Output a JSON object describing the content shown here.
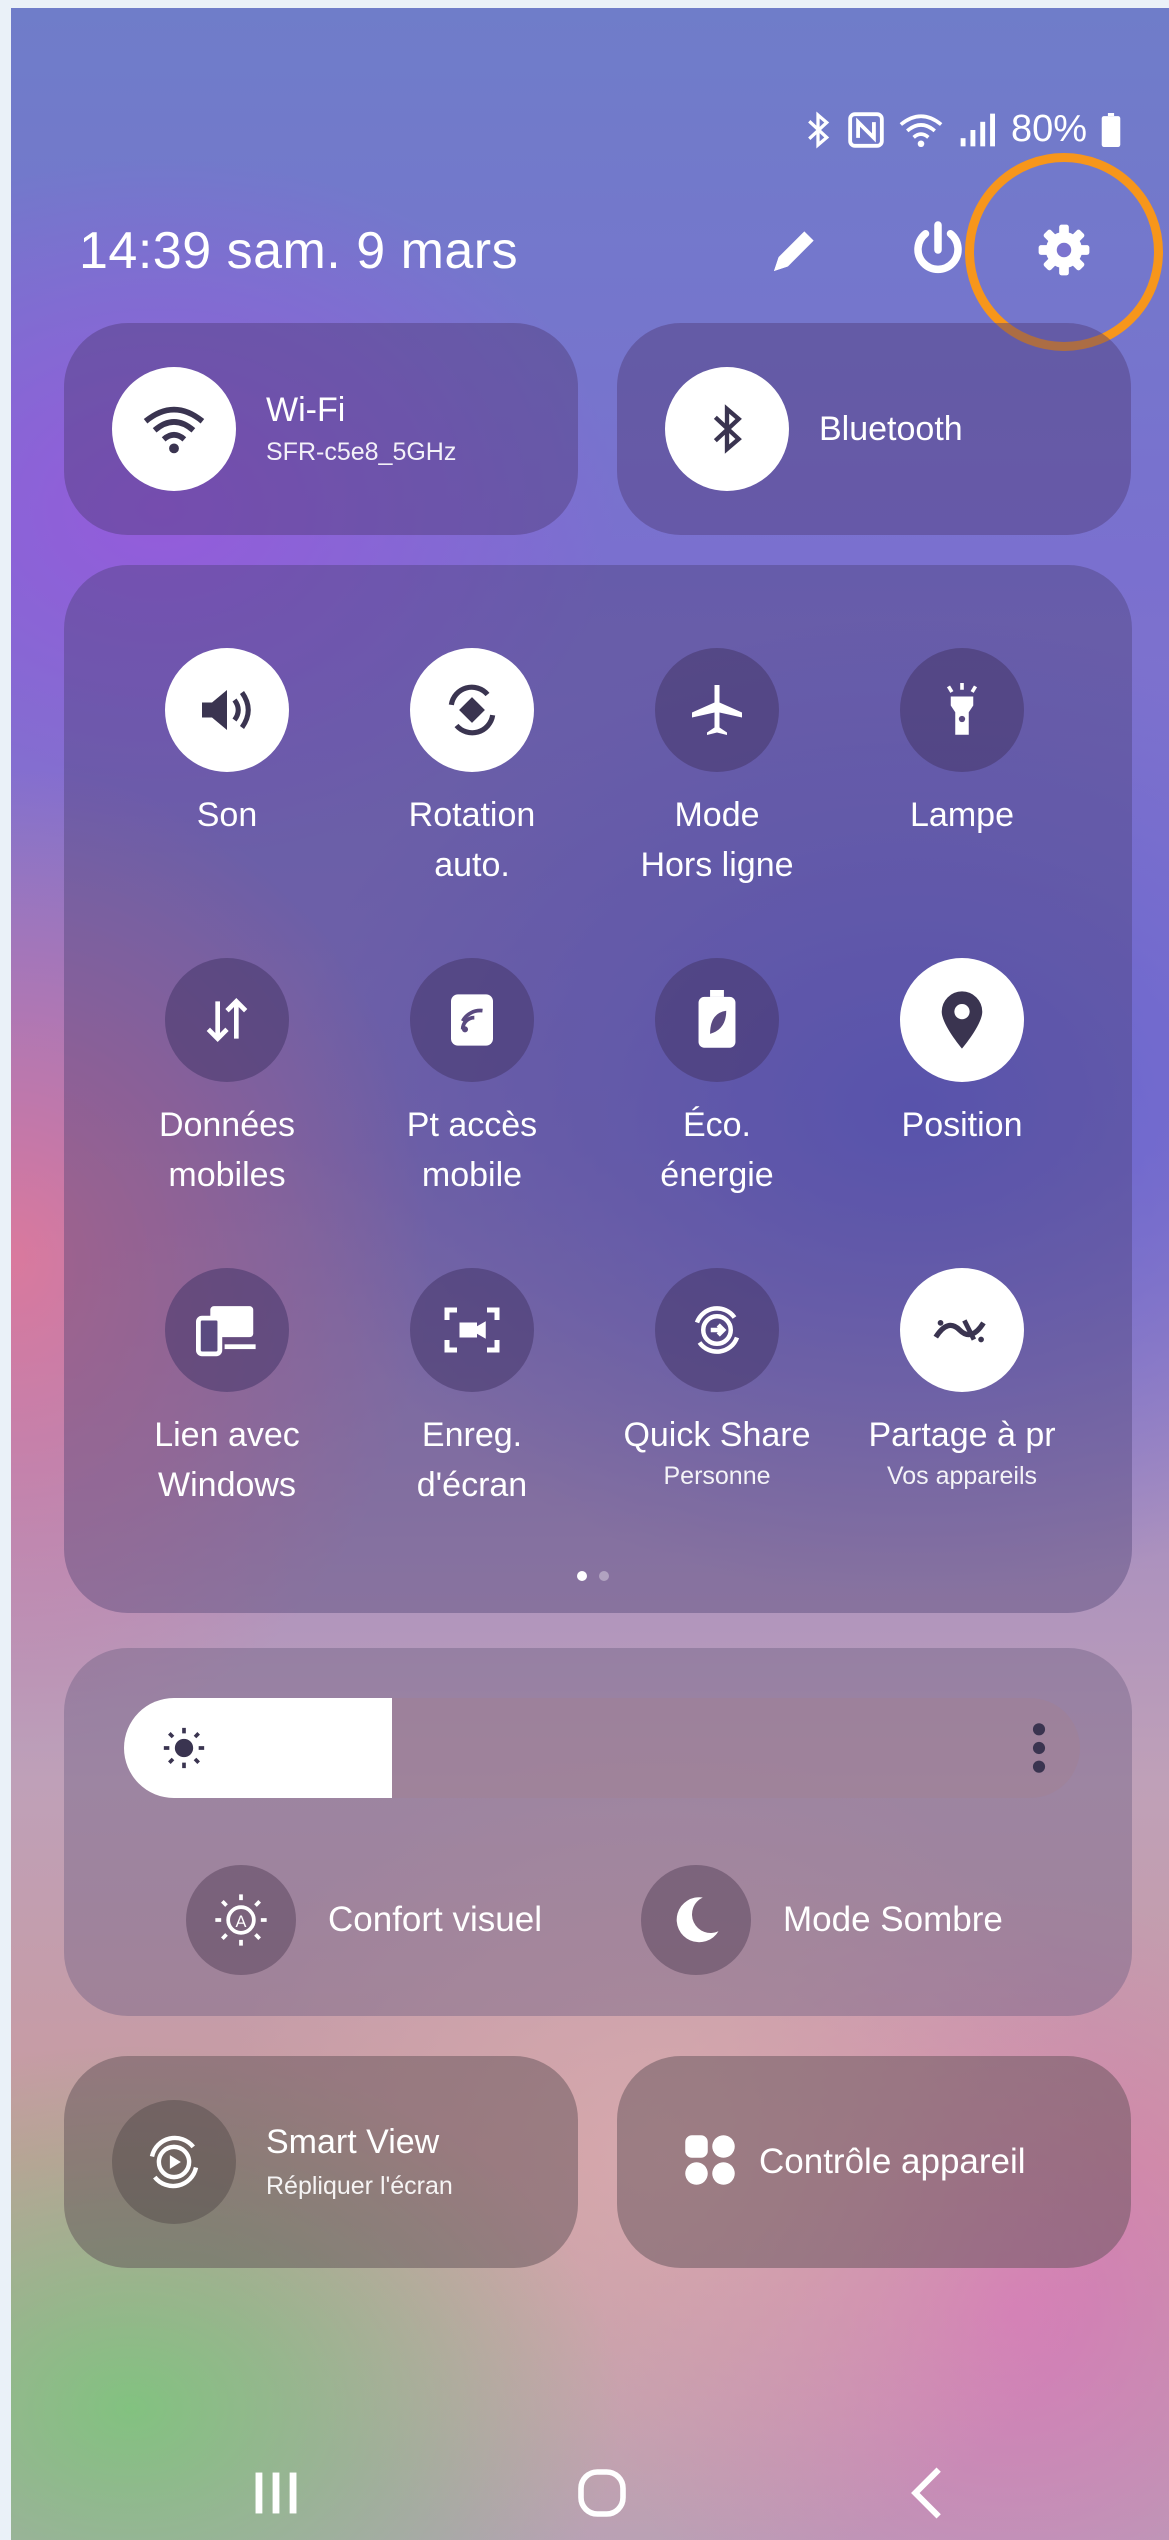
{
  "status_bar": {
    "battery": "80%",
    "icons": [
      "bluetooth-icon",
      "nfc-icon",
      "wifi-icon",
      "signal-icon",
      "battery-icon"
    ]
  },
  "header": {
    "datetime": "14:39  sam. 9 mars",
    "actions": [
      "edit-icon",
      "power-icon",
      "settings-icon"
    ]
  },
  "top_tiles": {
    "wifi": {
      "label": "Wi-Fi",
      "network": "SFR-c5e8_5GHz"
    },
    "bluetooth": {
      "label": "Bluetooth"
    }
  },
  "quick_tiles": [
    {
      "label1": "Son",
      "label2": "",
      "sub": "",
      "icon": "volume-icon",
      "on": true
    },
    {
      "label1": "Rotation",
      "label2": "auto.",
      "sub": "",
      "icon": "rotation-icon",
      "on": true
    },
    {
      "label1": "Mode",
      "label2": "Hors ligne",
      "sub": "",
      "icon": "airplane-icon",
      "on": false
    },
    {
      "label1": "Lampe",
      "label2": "",
      "sub": "",
      "icon": "flashlight-icon",
      "on": false
    },
    {
      "label1": "Données",
      "label2": "mobiles",
      "sub": "",
      "icon": "mobile-data-icon",
      "on": false
    },
    {
      "label1": "Pt accès",
      "label2": "mobile",
      "sub": "",
      "icon": "hotspot-icon",
      "on": false
    },
    {
      "label1": "Éco.",
      "label2": "énergie",
      "sub": "",
      "icon": "power-saving-icon",
      "on": false
    },
    {
      "label1": "Position",
      "label2": "",
      "sub": "",
      "icon": "location-icon",
      "on": true
    },
    {
      "label1": "Lien avec",
      "label2": "Windows",
      "sub": "",
      "icon": "link-windows-icon",
      "on": false
    },
    {
      "label1": "Enreg.",
      "label2": "d'écran",
      "sub": "",
      "icon": "screen-record-icon",
      "on": false
    },
    {
      "label1": "Quick Share",
      "label2": "",
      "sub": "Personne",
      "icon": "quick-share-icon",
      "on": false
    },
    {
      "label1": "Partage à pr",
      "label2": "",
      "sub": "Vos appareils",
      "icon": "nearby-share-icon",
      "on": true
    }
  ],
  "pager": {
    "pages": 2,
    "current": 1
  },
  "brightness": {
    "level_fraction": 0.28,
    "icons": [
      "sun-icon",
      "more-options-icon"
    ]
  },
  "toggles": {
    "eye_comfort": "Confort visuel",
    "dark_mode": "Mode Sombre"
  },
  "bottom_tiles": {
    "smart_view": {
      "label": "Smart View",
      "sub": "Répliquer l'écran"
    },
    "device_control": {
      "label": "Contrôle appareil"
    }
  },
  "nav": [
    "recents-icon",
    "home-icon",
    "back-icon"
  ],
  "colors": {
    "highlight": "#f7961b",
    "tile_on": "#ffffff"
  }
}
